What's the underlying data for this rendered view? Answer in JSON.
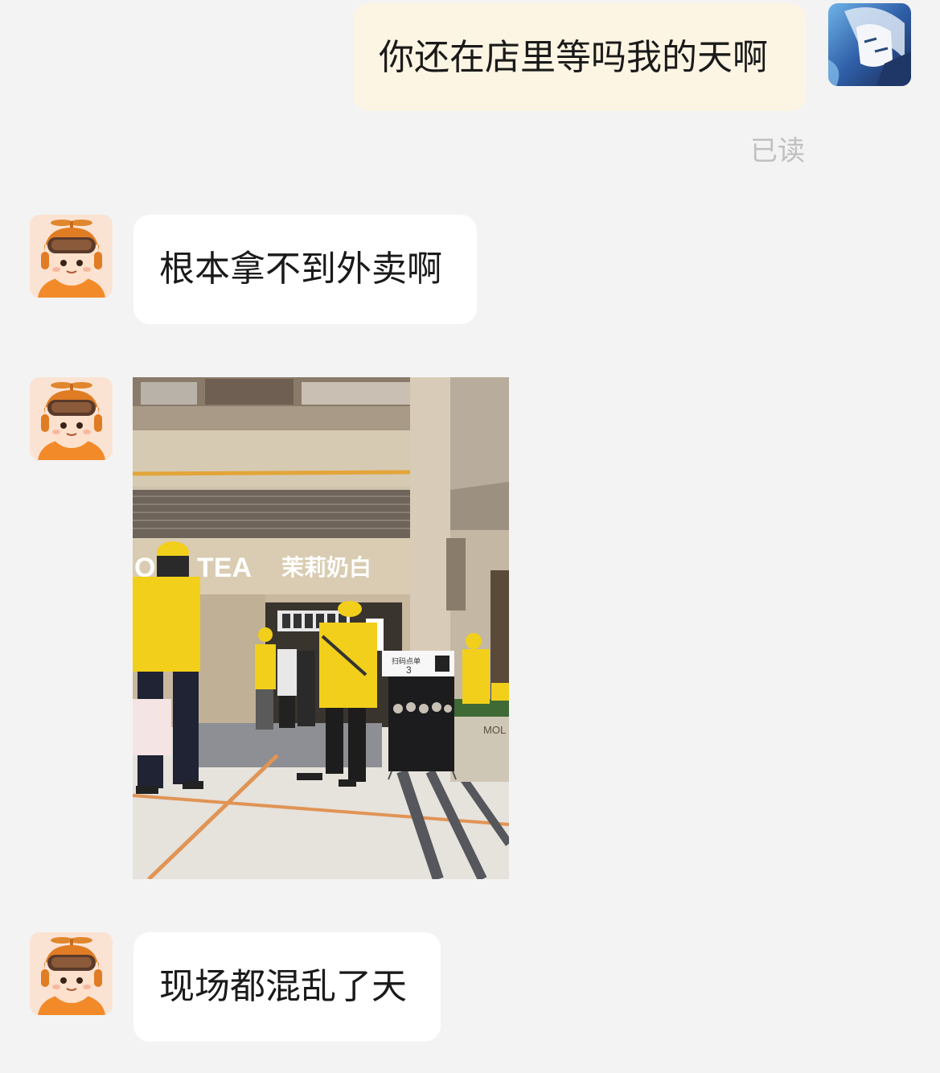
{
  "messages": [
    {
      "sender": "self",
      "avatar": "user-avatar",
      "text": "你还在店里等吗我的天啊",
      "status": "已读"
    },
    {
      "sender": "other",
      "avatar": "courier-avatar",
      "text": "根本拿不到外卖啊"
    },
    {
      "sender": "other",
      "avatar": "courier-avatar",
      "type": "image",
      "image": "photo of crowded milk tea shop entrance with delivery riders in yellow uniforms",
      "image_text": {
        "store_logo": "TEA",
        "store_name": "茉莉奶白",
        "planter_logo": "MOL",
        "poster_top": "扫码点单",
        "poster_num": "3"
      }
    },
    {
      "sender": "other",
      "avatar": "courier-avatar",
      "text": "现场都混乱了天"
    }
  ],
  "colors": {
    "background": "#f3f3f3",
    "self_bubble": "#fdf5e3",
    "other_bubble": "#ffffff",
    "read_status": "#c0c0c0",
    "rider_yellow": "#f2cf1b"
  }
}
